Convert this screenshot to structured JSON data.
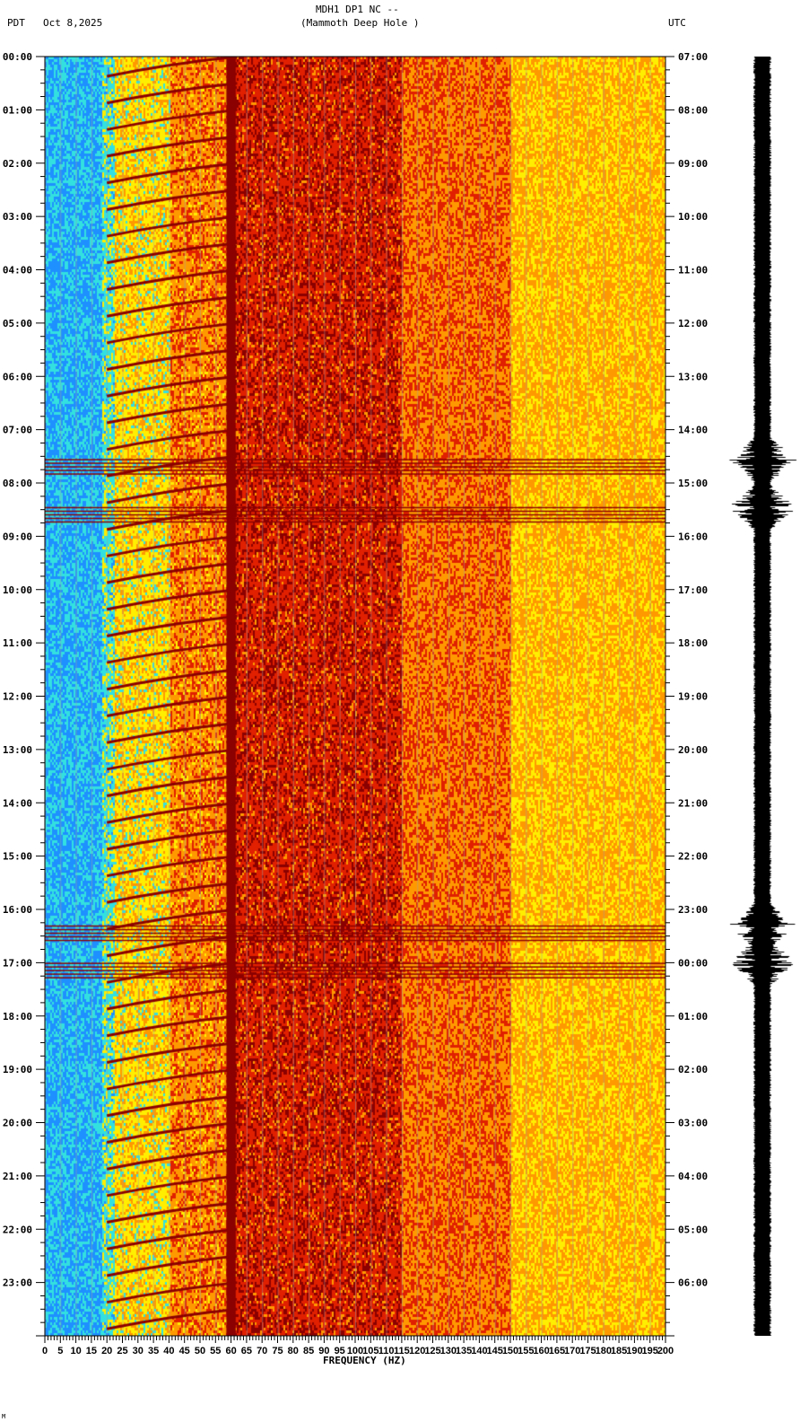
{
  "header": {
    "title": "MDH1 DP1 NC --",
    "subtitle": "(Mammoth Deep Hole )",
    "left_tz": "PDT",
    "date": "Oct 8,2025",
    "right_tz": "UTC"
  },
  "footer_mark": "M",
  "chart_data": {
    "type": "heatmap",
    "title": "MDH1 DP1 NC --",
    "xlabel": "FREQUENCY (HZ)",
    "ylabel_left": "PDT",
    "ylabel_right": "UTC",
    "xlim": [
      0,
      200
    ],
    "ylim_hours": [
      0,
      24
    ],
    "x_ticks": [
      "0",
      "5",
      "10",
      "15",
      "20",
      "25",
      "30",
      "35",
      "40",
      "45",
      "50",
      "55",
      "60",
      "65",
      "70",
      "75",
      "80",
      "85",
      "90",
      "95",
      "100",
      "105",
      "110",
      "115",
      "120",
      "125",
      "130",
      "135",
      "140",
      "145",
      "150",
      "155",
      "160",
      "165",
      "170",
      "175",
      "180",
      "185",
      "190",
      "195",
      "200"
    ],
    "y_ticks_left": [
      "00:00",
      "01:00",
      "02:00",
      "03:00",
      "04:00",
      "05:00",
      "06:00",
      "07:00",
      "08:00",
      "09:00",
      "10:00",
      "11:00",
      "12:00",
      "13:00",
      "14:00",
      "15:00",
      "16:00",
      "17:00",
      "18:00",
      "19:00",
      "20:00",
      "21:00",
      "22:00",
      "23:00"
    ],
    "y_ticks_right": [
      "07:00",
      "08:00",
      "09:00",
      "10:00",
      "11:00",
      "12:00",
      "13:00",
      "14:00",
      "15:00",
      "16:00",
      "17:00",
      "18:00",
      "19:00",
      "20:00",
      "21:00",
      "22:00",
      "23:00",
      "00:00",
      "01:00",
      "02:00",
      "03:00",
      "04:00",
      "05:00",
      "06:00"
    ],
    "notable_line_hz": 60,
    "event_hours": [
      7.55,
      8.45,
      16.3,
      17.0
    ],
    "colors": {
      "low": "#1e90ff",
      "cyan": "#33e0e0",
      "yellow": "#ffee00",
      "orange": "#ff9900",
      "red": "#e02000",
      "darkred": "#8b0000"
    }
  }
}
